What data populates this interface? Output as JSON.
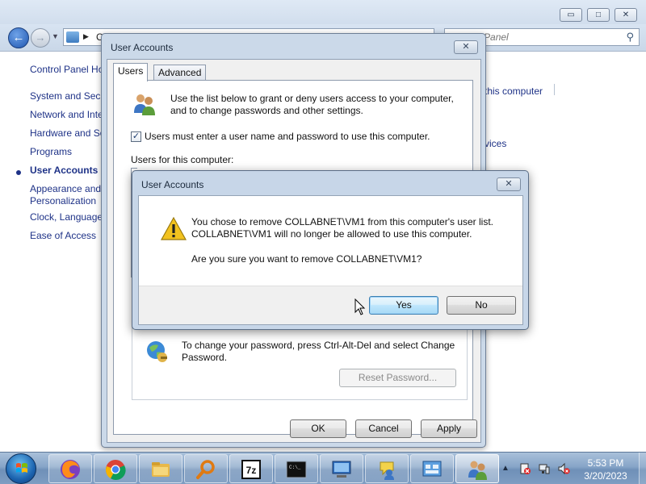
{
  "control_panel": {
    "window_controls": {
      "minimize": "▭",
      "maximize": "□",
      "close": "✕"
    },
    "address_text": "C",
    "search_placeholder": "Control Panel",
    "sidebar": {
      "home": "Control Panel Ho",
      "items": [
        {
          "label": "System and Secu"
        },
        {
          "label": "Network and Inte"
        },
        {
          "label": "Hardware and So"
        },
        {
          "label": "Programs"
        },
        {
          "label": "User Accounts"
        },
        {
          "label": "Appearance and"
        },
        {
          "label": "Personalization"
        },
        {
          "label": "Clock, Language"
        },
        {
          "label": "Ease of Access"
        }
      ]
    },
    "right_links": [
      "this computer",
      "vices"
    ]
  },
  "user_accounts": {
    "title": "User Accounts",
    "close": "✕",
    "tabs": [
      {
        "label": "Users"
      },
      {
        "label": "Advanced"
      }
    ],
    "intro": "Use the list below to grant or deny users access to your computer, and to change passwords and other settings.",
    "checkbox_label": "Users must enter a user name and password to use this computer.",
    "checkbox_checked": true,
    "users_label": "Users for this computer:",
    "list_fragments": [
      "U",
      "C"
    ],
    "password_text": "To change your password, press Ctrl-Alt-Del and select Change Password.",
    "reset_password": "Reset Password...",
    "buttons": {
      "ok": "OK",
      "cancel": "Cancel",
      "apply": "Apply"
    }
  },
  "confirm": {
    "title": "User Accounts",
    "close": "✕",
    "message": "You chose to remove COLLABNET\\VM1 from this computer's user list. COLLABNET\\VM1 will no longer be allowed to use this computer.",
    "question": "Are you sure you want to remove COLLABNET\\VM1?",
    "yes": "Yes",
    "no": "No"
  },
  "taskbar": {
    "apps": [
      {
        "icon": "firefox-icon"
      },
      {
        "icon": "chrome-icon"
      },
      {
        "icon": "file-explorer-icon"
      },
      {
        "icon": "search-tool-icon"
      },
      {
        "icon": "7zip-icon",
        "text": "7z"
      },
      {
        "icon": "command-prompt-icon",
        "text": "C:\\_"
      },
      {
        "icon": "remote-desktop-icon"
      },
      {
        "icon": "help-user-icon"
      },
      {
        "icon": "control-panel-icon"
      },
      {
        "icon": "user-accounts-icon"
      }
    ],
    "tray_arrow": "▲",
    "time": "5:53 PM",
    "date": "3/20/2023",
    "accent": "#1e3287"
  }
}
